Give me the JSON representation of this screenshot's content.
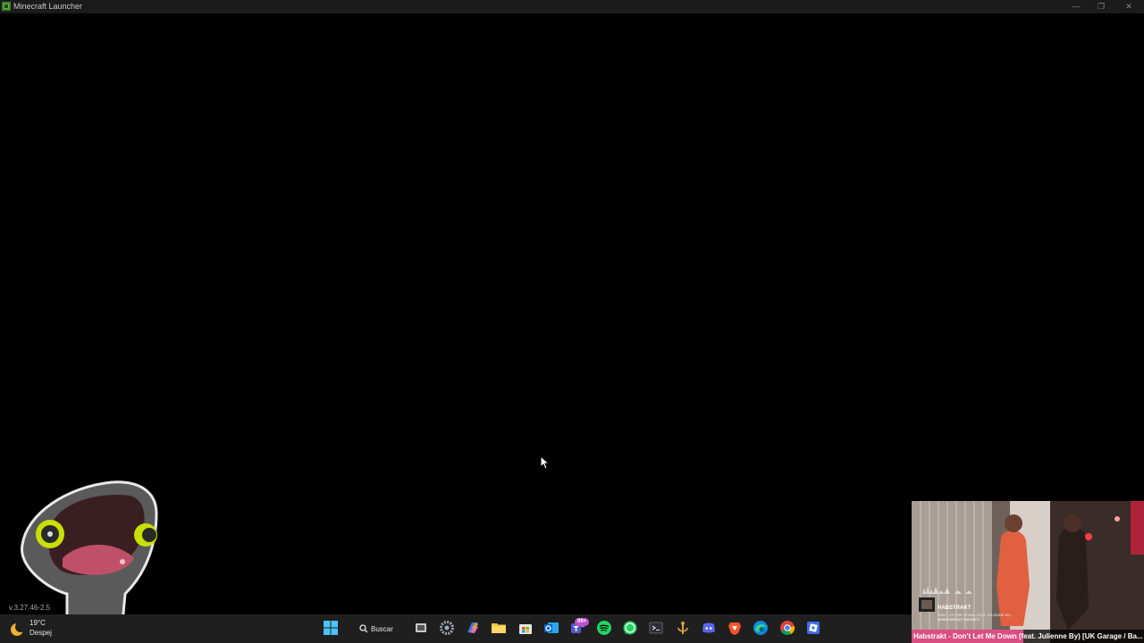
{
  "window": {
    "title": "Minecraft Launcher",
    "controls": {
      "minimize": "—",
      "restore": "❐",
      "close": "✕"
    }
  },
  "launcher": {
    "version": "v.3.27.46-2.5"
  },
  "weather": {
    "temperature": "19°C",
    "condition": "Despej",
    "icon": "crescent-moon-icon"
  },
  "taskbar": {
    "search_label": "Buscar",
    "notification_badge": "99+",
    "icons": [
      "start-icon",
      "search-icon",
      "task-view-icon",
      "settings-icon",
      "copilot-icon",
      "file-explorer-icon",
      "microsoft-store-icon",
      "outlook-icon",
      "teams-icon",
      "spotify-icon",
      "whatsapp-icon",
      "terminal-icon",
      "game-launcher-icon",
      "discord-icon",
      "brave-icon",
      "edge-icon",
      "chrome-icon",
      "roblox-studio-icon"
    ]
  },
  "video": {
    "title_bar": "Habstrakt - Don't Let Me Down (feat. Julienne By) [UK Garage / Ba...",
    "overlay_artist": "HABSTRAKT",
    "overlay_song": "DON'T LET ME DOWN (FEAT. JULIENNE BY)",
    "overlay_label": "MONSTERCAT INSTINCT"
  },
  "colors": {
    "titlebar": "#1b1b1b",
    "taskbar": "#1f1f1f",
    "video_title_highlight": "#d94f80",
    "mascot_eye": "#c8e000"
  }
}
